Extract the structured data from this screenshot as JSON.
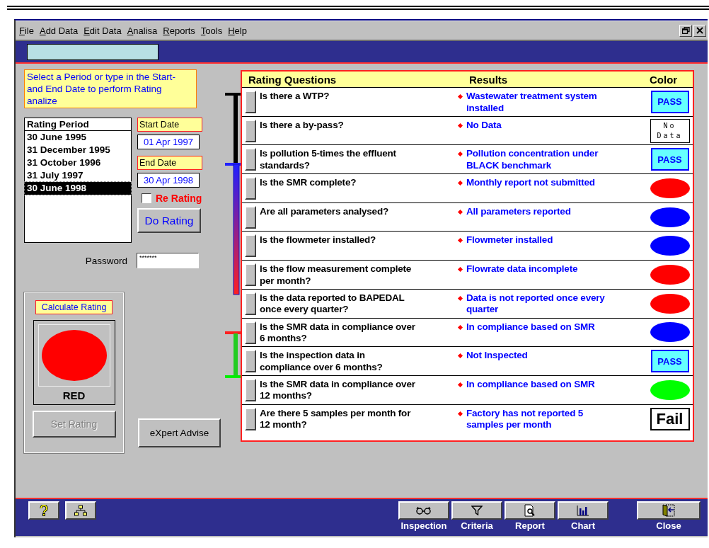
{
  "menu": [
    {
      "label": "File"
    },
    {
      "label": "Add Data"
    },
    {
      "label": "Edit Data"
    },
    {
      "label": "Analisa"
    },
    {
      "label": "Reports"
    },
    {
      "label": "Tools"
    },
    {
      "label": "Help"
    }
  ],
  "instruction": "Select a Period or type in the Start- and End Date to perform Rating analize",
  "rating_period": {
    "header": "Rating Period",
    "items": [
      {
        "label": "30 June 1995",
        "selected": false
      },
      {
        "label": "31 December 1995",
        "selected": false
      },
      {
        "label": "31 October 1996",
        "selected": false
      },
      {
        "label": "31 July 1997",
        "selected": false
      },
      {
        "label": "30 June 1998",
        "selected": true
      }
    ]
  },
  "start_date": {
    "label": "Start Date",
    "value": "01 Apr 1997"
  },
  "end_date": {
    "label": "End Date",
    "value": "30 Apr 1998"
  },
  "re_rating": {
    "label": "Re Rating",
    "checked": false
  },
  "do_rating_button": "Do Rating",
  "password": {
    "label": "Password",
    "value": "*******"
  },
  "calculate": {
    "title": "Calculate Rating",
    "result_label": "RED",
    "color": "#ff0000"
  },
  "set_rating_button": {
    "label": "Set Rating",
    "disabled": true
  },
  "expert_button": "eXpert Advise",
  "table": {
    "columns": [
      "Rating Questions",
      "Results",
      "Color"
    ],
    "rows": [
      {
        "question": "Is there a WTP?",
        "result": "Wastewater treatment system installed",
        "indicator": {
          "kind": "pass",
          "text": "PASS"
        }
      },
      {
        "question": "Is there a by-pass?",
        "result": "No Data",
        "indicator": {
          "kind": "nodata",
          "text": "No Data"
        }
      },
      {
        "question": "Is pollution 5-times the effluent standards?",
        "result": "Pollution concentration under BLACK benchmark",
        "indicator": {
          "kind": "pass",
          "text": "PASS"
        }
      },
      {
        "question": "Is the SMR complete?",
        "result": "Monthly report not submitted",
        "indicator": {
          "kind": "dot",
          "color": "#ff0000"
        }
      },
      {
        "question": "Are all parameters analysed?",
        "result": "All parameters reported",
        "indicator": {
          "kind": "dot",
          "color": "#0000ff"
        }
      },
      {
        "question": "Is the flowmeter installed?",
        "result": "Flowmeter installed",
        "indicator": {
          "kind": "dot",
          "color": "#0000ff"
        }
      },
      {
        "question": "Is the flow measurement complete per month?",
        "result": "Flowrate data incomplete",
        "indicator": {
          "kind": "dot",
          "color": "#ff0000"
        }
      },
      {
        "question": "Is the data reported to BAPEDAL once every quarter?",
        "result": "Data is not reported once every quarter",
        "indicator": {
          "kind": "dot",
          "color": "#ff0000"
        }
      },
      {
        "question": "Is the SMR data in compliance over 6 months?",
        "result": "In compliance based on SMR",
        "indicator": {
          "kind": "dot",
          "color": "#0000ff"
        }
      },
      {
        "question": "Is the inspection data in compliance over 6 months?",
        "result": "Not Inspected",
        "indicator": {
          "kind": "pass",
          "text": "PASS"
        }
      },
      {
        "question": "Is the SMR data in compliance over 12 months?",
        "result": "In compliance based on SMR",
        "indicator": {
          "kind": "dot",
          "color": "#00ff00"
        }
      },
      {
        "question": "Are there 5 samples per month for 12 month?",
        "result": "Factory has not reported 5 samples per month",
        "indicator": {
          "kind": "fail",
          "text": "Fail"
        }
      }
    ]
  },
  "toolbar": [
    {
      "label": "Inspection"
    },
    {
      "label": "Criteria"
    },
    {
      "label": "Report"
    },
    {
      "label": "Chart"
    }
  ],
  "close_button": "Close"
}
